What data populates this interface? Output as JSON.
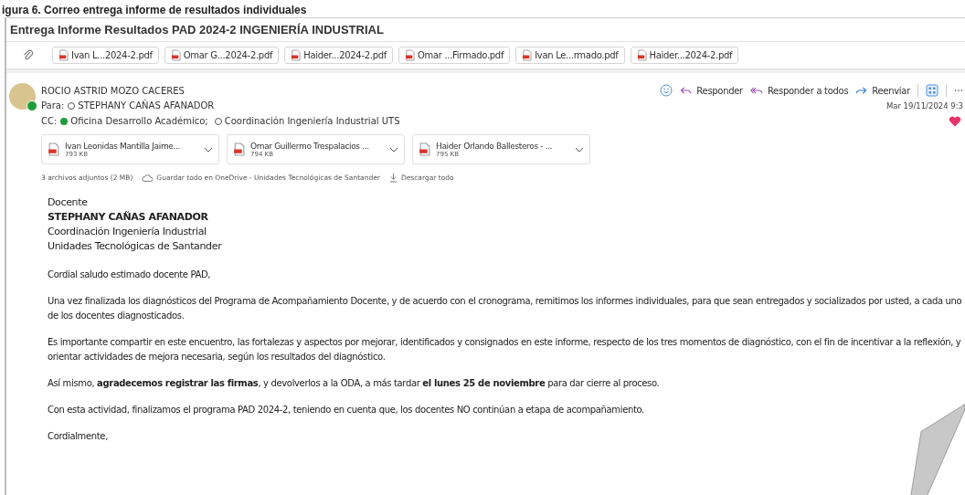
{
  "caption": "igura 6. Correo entrega informe de resultados individuales",
  "subject": "Entrega Informe Resultados PAD 2024-2 INGENIERÍA INDUSTRIAL",
  "top_attachments": [
    {
      "name": "Ivan L...2024-2.pdf"
    },
    {
      "name": "Omar G...2024-2.pdf"
    },
    {
      "name": "Haider...2024-2.pdf"
    },
    {
      "name": "Omar ...Firmado.pdf"
    },
    {
      "name": "Ivan Le...rmado.pdf"
    },
    {
      "name": "Haider...2024-2.pdf"
    }
  ],
  "sender": {
    "name": "ROCIO ASTRID MOZO CACERES",
    "online": true
  },
  "to": {
    "label": "Para:",
    "recipients": [
      {
        "name": "STEPHANY CAÑAS AFANADOR",
        "verified": false
      }
    ]
  },
  "cc": {
    "label": "CC:",
    "recipients": [
      {
        "name": "Oficina Desarrollo Académico;",
        "verified": true
      },
      {
        "name": "Coordinación Ingeniería Industrial UTS",
        "verified": false
      }
    ]
  },
  "actions": [
    {
      "kind": "emoji"
    },
    {
      "kind": "reply",
      "label": "Responder"
    },
    {
      "kind": "replyall",
      "label": "Responder a todos"
    },
    {
      "kind": "forward",
      "label": "Reenviar"
    },
    {
      "kind": "apps"
    },
    {
      "kind": "more"
    }
  ],
  "date": "Mar 19/11/2024 9:3",
  "attachments": [
    {
      "name": "Ivan Leonidas Mantilla Jaime...",
      "size": "793 KB"
    },
    {
      "name": "Omar Guillermo Trespalacios ...",
      "size": "794 KB"
    },
    {
      "name": "Haider Orlando Ballesteros - ...",
      "size": "795 KB"
    }
  ],
  "attachment_summary": "3 archivos adjuntos (2 MB)",
  "save_all": "Guardar todo en OneDrive - Unidades Tecnológicas de Santander",
  "download_all": "Descargar todo",
  "address": [
    {
      "text": "Docente",
      "bold": false
    },
    {
      "text": "STEPHANY CAÑAS AFANADOR",
      "bold": true
    },
    {
      "text": "Coordinación Ingeniería Industrial",
      "bold": false
    },
    {
      "text": "Unidades Tecnológicas de Santander",
      "bold": false
    }
  ],
  "paragraphs": [
    "Cordial saludo estimado docente PAD,",
    "Una vez finalizada los diagnósticos del Programa de Acompañamiento Docente, y de acuerdo con el cronograma, remitimos los informes individuales, para que sean entregados y socializados por usted, a cada uno de los docentes diagnosticados.",
    "Es importante compartir en este encuentro, las fortalezas y aspectos por mejorar, identificados y consignados en este informe, respecto de los tres momentos de diagnóstico, con el fin de incentivar a la reflexión, y orientar actividades de mejora necesaria, según los resultados del diagnóstico.",
    "Así mismo, **agradecemos registrar las firmas**, y devolverlos a la ODA, a más tardar **el lunes 25 de noviembre** para dar cierre al proceso.",
    "Con esta actividad, finalizamos el programa PAD 2024-2, teniendo en cuenta que, los docentes NO continúan a etapa de acompañamiento.",
    "Cordialmente,"
  ]
}
